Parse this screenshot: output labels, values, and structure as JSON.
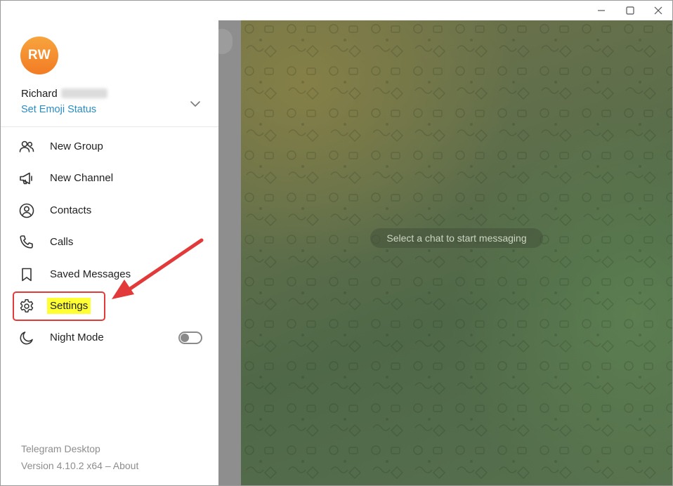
{
  "window": {
    "controls": [
      "minimize",
      "maximize",
      "close"
    ]
  },
  "profile": {
    "initials": "RW",
    "first_name": "Richard",
    "emoji_status_link": "Set Emoji Status",
    "avatar_colors": [
      "#f7a43d",
      "#f27b24"
    ]
  },
  "menu": {
    "items": [
      {
        "label": "New Group",
        "icon": "people-icon"
      },
      {
        "label": "New Channel",
        "icon": "megaphone-icon"
      },
      {
        "label": "Contacts",
        "icon": "person-circle-icon"
      },
      {
        "label": "Calls",
        "icon": "phone-icon"
      },
      {
        "label": "Saved Messages",
        "icon": "bookmark-icon"
      },
      {
        "label": "Settings",
        "icon": "gear-icon",
        "highlighted": true
      },
      {
        "label": "Night Mode",
        "icon": "moon-icon",
        "toggle": false
      }
    ]
  },
  "footer": {
    "app_name": "Telegram Desktop",
    "version": "Version 4.10.2 x64 – ",
    "about_link": "About"
  },
  "chat": {
    "empty_message": "Select a chat to start messaging"
  },
  "colors": {
    "accent_link": "#2b8cc4",
    "annotation_red": "#e23a3a",
    "highlight_yellow": "#ffff33"
  }
}
